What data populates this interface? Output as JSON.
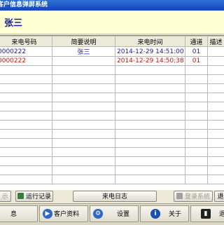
{
  "window": {
    "title": "客户信息弹屏系统"
  },
  "caller": {
    "name": "张三"
  },
  "table": {
    "headers": [
      "来电号码",
      "简要说明",
      "来电时间",
      "通道",
      "描述"
    ],
    "rows": [
      {
        "number": "0000222",
        "note": "张三",
        "time": "2014-12-29 14:51:00",
        "channel": "01",
        "desc": ""
      },
      {
        "number": "0000222",
        "note": "",
        "time": "2014-12-29 14:50:38",
        "channel": "01",
        "desc": ""
      }
    ]
  },
  "toolbar": {
    "left_partial": "示",
    "run_log": "运行记录",
    "call_log": "来电日志",
    "login": "登录系统",
    "right_partial": "退"
  },
  "tabs": [
    {
      "label": "息",
      "icon": "info-icon"
    },
    {
      "label": "客户资料",
      "icon": "customer-icon"
    },
    {
      "label": "设置",
      "icon": "settings-icon"
    },
    {
      "label": "关于",
      "icon": "about-icon"
    },
    {
      "label": "退",
      "icon": "exit-icon"
    }
  ],
  "colors": {
    "title_bar": "#1a56c8",
    "caller_bg": "#ffffd2",
    "row_blue": "#1a1aa0",
    "row_red": "#c8140a"
  }
}
